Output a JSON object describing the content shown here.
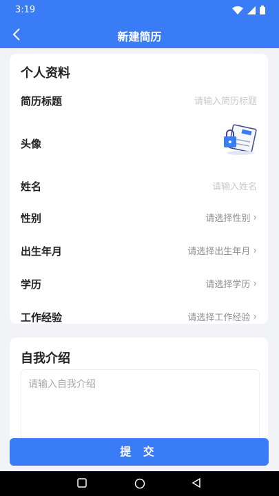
{
  "status_bar": {
    "time": "3:19"
  },
  "header": {
    "title": "新建简历"
  },
  "personal": {
    "section_title": "个人资料",
    "fields": [
      {
        "label": "简历标题",
        "placeholder": "请输入简历标题"
      },
      {
        "label": "头像"
      },
      {
        "label": "姓名",
        "placeholder": "请输入姓名"
      },
      {
        "label": "性别",
        "value": "请选择性别"
      },
      {
        "label": "出生年月",
        "value": "请选择出生年月"
      },
      {
        "label": "学历",
        "value": "请选择学历"
      },
      {
        "label": "工作经验",
        "value": "请选择工作经验"
      }
    ]
  },
  "intro": {
    "section_title": "自我介绍",
    "placeholder": "请输入自我介绍"
  },
  "submit_label": "提 交",
  "colors": {
    "accent": "#3a7bf6",
    "background": "#f2f3f7"
  },
  "icons": [
    "back-arrow-icon",
    "wifi-icon",
    "signal-icon",
    "battery-icon",
    "avatar-illustration-icon",
    "chevron-right-icon"
  ]
}
